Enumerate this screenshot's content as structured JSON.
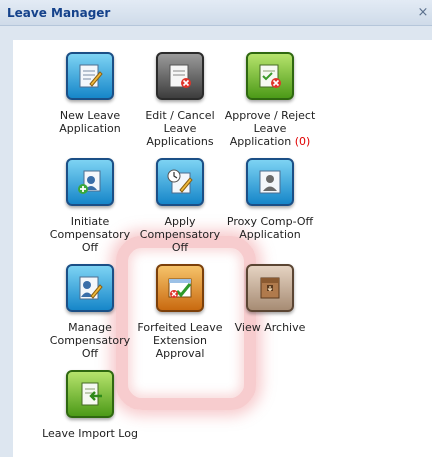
{
  "window": {
    "title": "Leave Manager",
    "close_symbol": "×"
  },
  "tiles": [
    {
      "label": "New Leave Application",
      "icon": "document-pencil-icon"
    },
    {
      "label": "Edit / Cancel Leave Applications",
      "icon": "document-cancel-icon"
    },
    {
      "label": "Approve / Reject Leave Application",
      "count": "(0)",
      "icon": "document-approve-reject-icon"
    },
    {
      "label": "Initiate Compensatory Off",
      "icon": "user-add-icon"
    },
    {
      "label": "Apply Compensatory Off",
      "icon": "clock-document-icon"
    },
    {
      "label": "Proxy Comp-Off Application",
      "icon": "user-document-icon"
    },
    {
      "label": "Manage Compensatory Off",
      "icon": "user-edit-icon"
    },
    {
      "label": "Forfeited Leave Extension Approval",
      "icon": "approve-check-icon"
    },
    {
      "label": "View Archive",
      "icon": "archive-box-icon"
    },
    {
      "label": "Leave Import Log",
      "icon": "import-document-icon"
    }
  ],
  "colors": {
    "title_text": "#15428b",
    "highlight": "#e86e73",
    "pending_count": "#e00000"
  }
}
